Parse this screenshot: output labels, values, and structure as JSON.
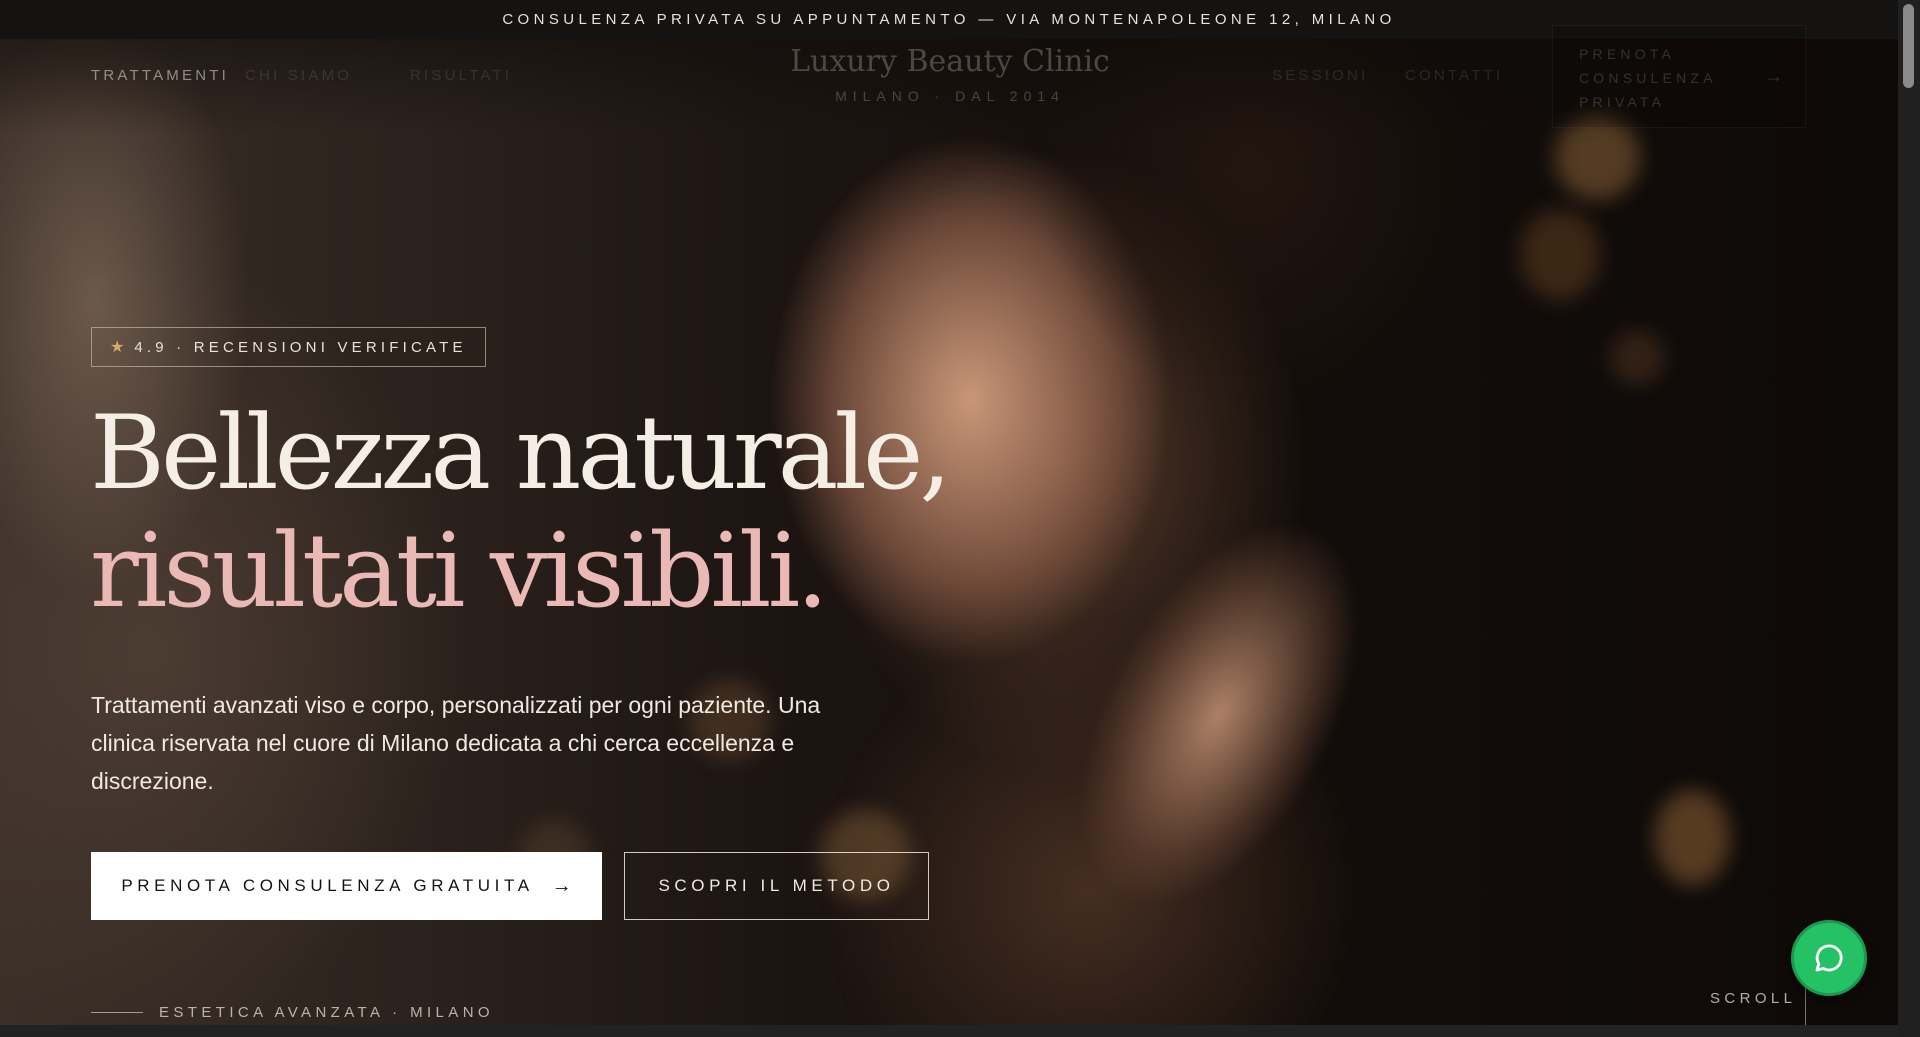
{
  "topbar": {
    "text": "CONSULENZA PRIVATA SU APPUNTAMENTO — VIA MONTENAPOLEONE 12, MILANO"
  },
  "nav": {
    "left_links": [
      "TRATTAMENTI",
      "CHI SIAMO",
      "RISULTATI"
    ],
    "logo": "Luxury Beauty Clinic",
    "logo_sub": "MILANO · DAL 2014",
    "right_links": [
      "SESSIONI",
      "CONTATTI"
    ],
    "cta_label": "PRENOTA CONSULENZA PRIVATA",
    "cta_arrow": "→"
  },
  "hero": {
    "badge_icon": "star-icon",
    "badge_text": "4.9 · RECENSIONI VERIFICATE",
    "headline_line1": "Bellezza naturale,",
    "headline_line2": "risultati visibili.",
    "lead": "Trattamenti avanzati viso e corpo, personalizzati per ogni paziente. Una clinica riservata nel cuore di Milano dedicata a chi cerca eccellenza e discrezione.",
    "primary_button": "PRENOTA CONSULENZA GRATUITA",
    "primary_arrow": "→",
    "secondary_button": "SCOPRI IL METODO",
    "tagline": "ESTETICA AVANZATA · MILANO",
    "scroll_label": "SCROLL"
  },
  "chat": {
    "icon": "chat-bubble-icon",
    "color": "#25c265"
  },
  "colors": {
    "accent_pink": "#eab9b5",
    "headline": "#f4eee4",
    "star": "#d9a86a"
  }
}
